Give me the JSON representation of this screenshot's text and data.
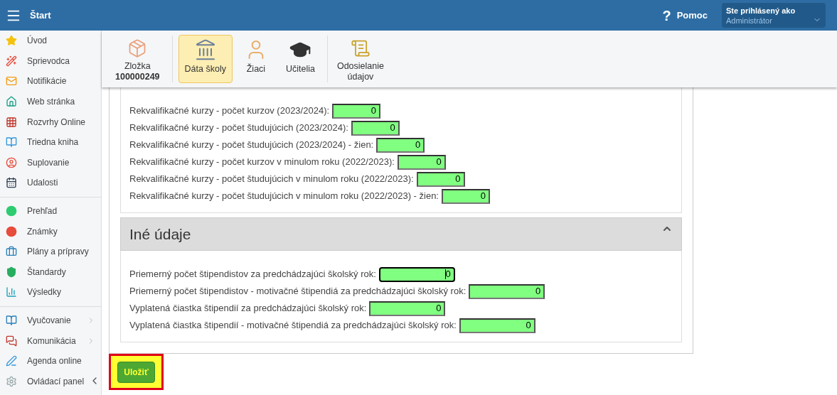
{
  "topbar": {
    "title": "Štart",
    "help_icon": "?",
    "help": "Pomoc",
    "user_label": "Ste prihlásený ako",
    "user_name": "Administrátor"
  },
  "sidebar": {
    "groups": [
      [
        {
          "label": "Úvod",
          "has_submenu": false
        },
        {
          "label": "Sprievodca",
          "has_submenu": false
        },
        {
          "label": "Notifikácie",
          "has_submenu": false
        },
        {
          "label": "Web stránka",
          "has_submenu": false
        },
        {
          "label": "Rozvrhy Online",
          "has_submenu": false
        },
        {
          "label": "Triedna kniha",
          "has_submenu": false
        },
        {
          "label": "Suplovanie",
          "has_submenu": false
        },
        {
          "label": "Udalosti",
          "has_submenu": false
        }
      ],
      [
        {
          "label": "Prehľad",
          "has_submenu": false
        },
        {
          "label": "Známky",
          "has_submenu": false
        },
        {
          "label": "Plány a prípravy",
          "has_submenu": false
        },
        {
          "label": "Štandardy",
          "has_submenu": false
        },
        {
          "label": "Výsledky",
          "has_submenu": false
        }
      ],
      [
        {
          "label": "Vyučovanie",
          "has_submenu": true
        },
        {
          "label": "Komunikácia",
          "has_submenu": true
        },
        {
          "label": "Agenda online",
          "has_submenu": false
        },
        {
          "label": "Ovládací panel",
          "has_submenu": false
        }
      ]
    ]
  },
  "toolbar": [
    {
      "label": "Zložka",
      "sublabel": "100000249",
      "selected": false
    },
    {
      "label": "Dáta školy",
      "selected": true,
      "divider_before": true
    },
    {
      "label": "Žiaci",
      "selected": false
    },
    {
      "label": "Učitelia",
      "selected": false
    },
    {
      "label": "Odosielanie údajov",
      "selected": false,
      "divider_before": true
    }
  ],
  "sections": [
    {
      "rows": [
        {
          "label": "Rekvalifikačné kurzy - počet kurzov (2023/2024):",
          "value": "0",
          "focused": false
        },
        {
          "label": "Rekvalifikačné kurzy - počet študujúcich (2023/2024):",
          "value": "0",
          "focused": false
        },
        {
          "label": "Rekvalifikačné kurzy - počet študujúcich (2023/2024) - žien:",
          "value": "0",
          "focused": false
        },
        {
          "label": "Rekvalifikačné kurzy - počet kurzov v minulom roku (2022/2023):",
          "value": "0",
          "focused": false
        },
        {
          "label": "Rekvalifikačné kurzy - počet študujúcich v minulom roku (2022/2023):",
          "value": "0",
          "focused": false
        },
        {
          "label": "Rekvalifikačné kurzy - počet študujúcich v minulom roku (2022/2023) - žien:",
          "value": "0",
          "focused": false
        }
      ]
    },
    {
      "title": "Iné údaje",
      "expanded": true,
      "rows": [
        {
          "label": "Priemerný počet štipendistov za predchádzajúci školský rok:",
          "value": "0",
          "focused": true
        },
        {
          "label": "Priemerný počet štipendistov - motivačné štipendiá za predchádzajúci školský rok:",
          "value": "0",
          "focused": false
        },
        {
          "label": "Vyplatená čiastka štipendií za predchádzajúci školský rok:",
          "value": "0",
          "focused": false
        },
        {
          "label": "Vyplatená čiastka štipendií - motivačné štipendiá za predchádzajúci školský rok:",
          "value": "0",
          "focused": false
        }
      ]
    }
  ],
  "save_button": {
    "label": "Uložiť",
    "highlighted": true
  }
}
